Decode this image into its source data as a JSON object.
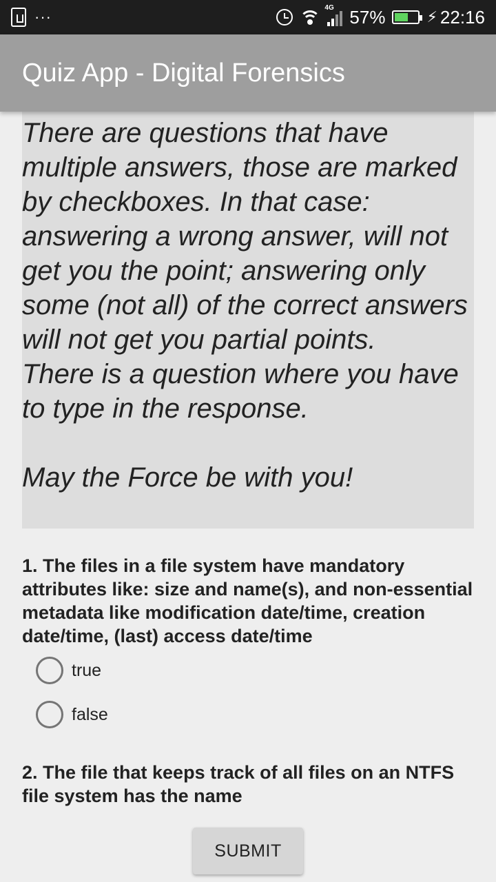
{
  "status_bar": {
    "left_icons": [
      "usb-icon",
      "more-dots-icon"
    ],
    "dots": "···",
    "network_type": "4G",
    "battery_percent": "57%",
    "battery_level": 0.57,
    "time": "22:16"
  },
  "app_bar": {
    "title": "Quiz App - Digital Forensics"
  },
  "instructions": {
    "text": "There are questions that have multiple answers, those are marked by checkboxes. In that case: answering a wrong answer, will not get you the point; answering only some (not all) of the correct answers will not get you partial points.\nThere is a question where you have to type in the response.\n\nMay the Force be with you!"
  },
  "questions": [
    {
      "text": "1. The files in a file system have mandatory attributes like: size and name(s), and non-essential metadata like modification date/time, creation date/time, (last) access date/time",
      "options": [
        "true",
        "false"
      ]
    },
    {
      "text": "2. The file that keeps track of all files on an NTFS file system has the name"
    }
  ],
  "submit_label": "SUBMIT",
  "colors": {
    "status_bar": "#1e1e1e",
    "app_bar": "#9e9e9e",
    "background": "#eeeeee",
    "instructions_bg": "#dddddd",
    "battery_fill": "#5fd35f"
  }
}
